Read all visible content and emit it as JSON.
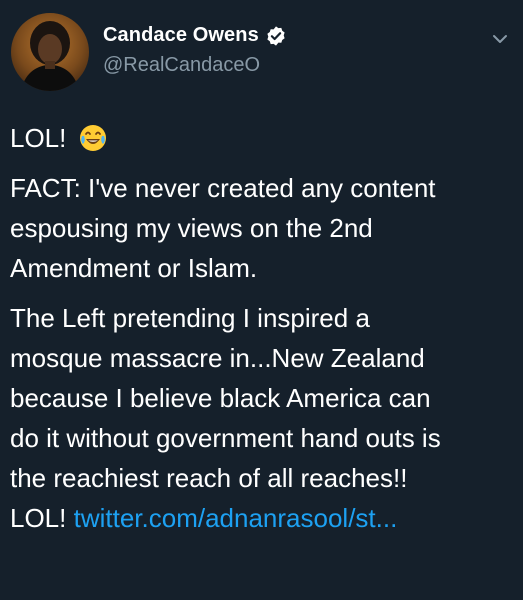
{
  "tweet": {
    "author": {
      "display_name": "Candace Owens",
      "handle": "@RealCandaceO",
      "verified": true
    },
    "lines": {
      "lol_first": "LOL!",
      "fact": "FACT: I've never created any content\nespousing my views on the 2nd\nAmendment or Islam.",
      "left": "The Left pretending I inspired a\nmosque massacre in...New Zealand\nbecause I believe black America can\ndo it without government hand outs is\nthe reachiest reach of all reaches!!",
      "lol_last": "LOL!",
      "link": "twitter.com/adnanrasool/st..."
    },
    "icons": {
      "verified": "verified-badge-icon",
      "emoji": "face-with-tears-of-joy-emoji",
      "menu": "chevron-down-icon"
    },
    "colors": {
      "background": "#15202b",
      "text": "#ffffff",
      "secondary": "#8899a6",
      "link": "#1da1f2"
    }
  }
}
